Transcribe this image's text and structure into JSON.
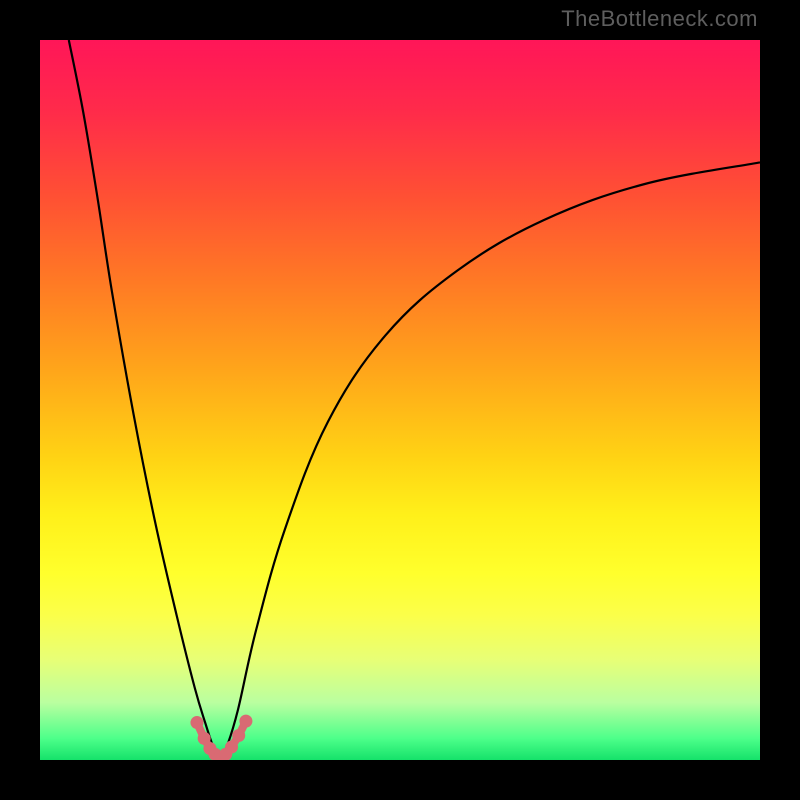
{
  "attribution": "TheBottleneck.com",
  "colors": {
    "frame": "#000000",
    "curve": "#000000",
    "dots": "#d96a73",
    "gradient_top": "#ff1658",
    "gradient_bottom": "#15e26a"
  },
  "chart_data": {
    "type": "line",
    "title": "",
    "xlabel": "",
    "ylabel": "",
    "xlim": [
      0,
      100
    ],
    "ylim": [
      0,
      100
    ],
    "series": [
      {
        "name": "left-curve",
        "values": [
          {
            "x": 4.0,
            "y": 100.0
          },
          {
            "x": 6.0,
            "y": 90.0
          },
          {
            "x": 8.0,
            "y": 78.0
          },
          {
            "x": 10.0,
            "y": 65.0
          },
          {
            "x": 13.0,
            "y": 48.0
          },
          {
            "x": 16.0,
            "y": 33.0
          },
          {
            "x": 19.0,
            "y": 20.0
          },
          {
            "x": 21.5,
            "y": 10.0
          },
          {
            "x": 23.0,
            "y": 5.0
          },
          {
            "x": 24.0,
            "y": 2.0
          },
          {
            "x": 25.0,
            "y": 0.0
          }
        ]
      },
      {
        "name": "right-curve",
        "values": [
          {
            "x": 25.0,
            "y": 0.0
          },
          {
            "x": 26.0,
            "y": 2.0
          },
          {
            "x": 27.5,
            "y": 7.0
          },
          {
            "x": 30.0,
            "y": 18.0
          },
          {
            "x": 34.0,
            "y": 32.0
          },
          {
            "x": 40.0,
            "y": 47.0
          },
          {
            "x": 48.0,
            "y": 59.0
          },
          {
            "x": 58.0,
            "y": 68.0
          },
          {
            "x": 70.0,
            "y": 75.0
          },
          {
            "x": 84.0,
            "y": 80.0
          },
          {
            "x": 100.0,
            "y": 83.0
          }
        ]
      },
      {
        "name": "valley-dots",
        "values": [
          {
            "x": 21.8,
            "y": 5.2
          },
          {
            "x": 22.8,
            "y": 3.0
          },
          {
            "x": 23.6,
            "y": 1.6
          },
          {
            "x": 24.3,
            "y": 0.8
          },
          {
            "x": 25.0,
            "y": 0.4
          },
          {
            "x": 25.8,
            "y": 0.8
          },
          {
            "x": 26.6,
            "y": 1.8
          },
          {
            "x": 27.6,
            "y": 3.4
          },
          {
            "x": 28.6,
            "y": 5.4
          }
        ]
      }
    ]
  }
}
